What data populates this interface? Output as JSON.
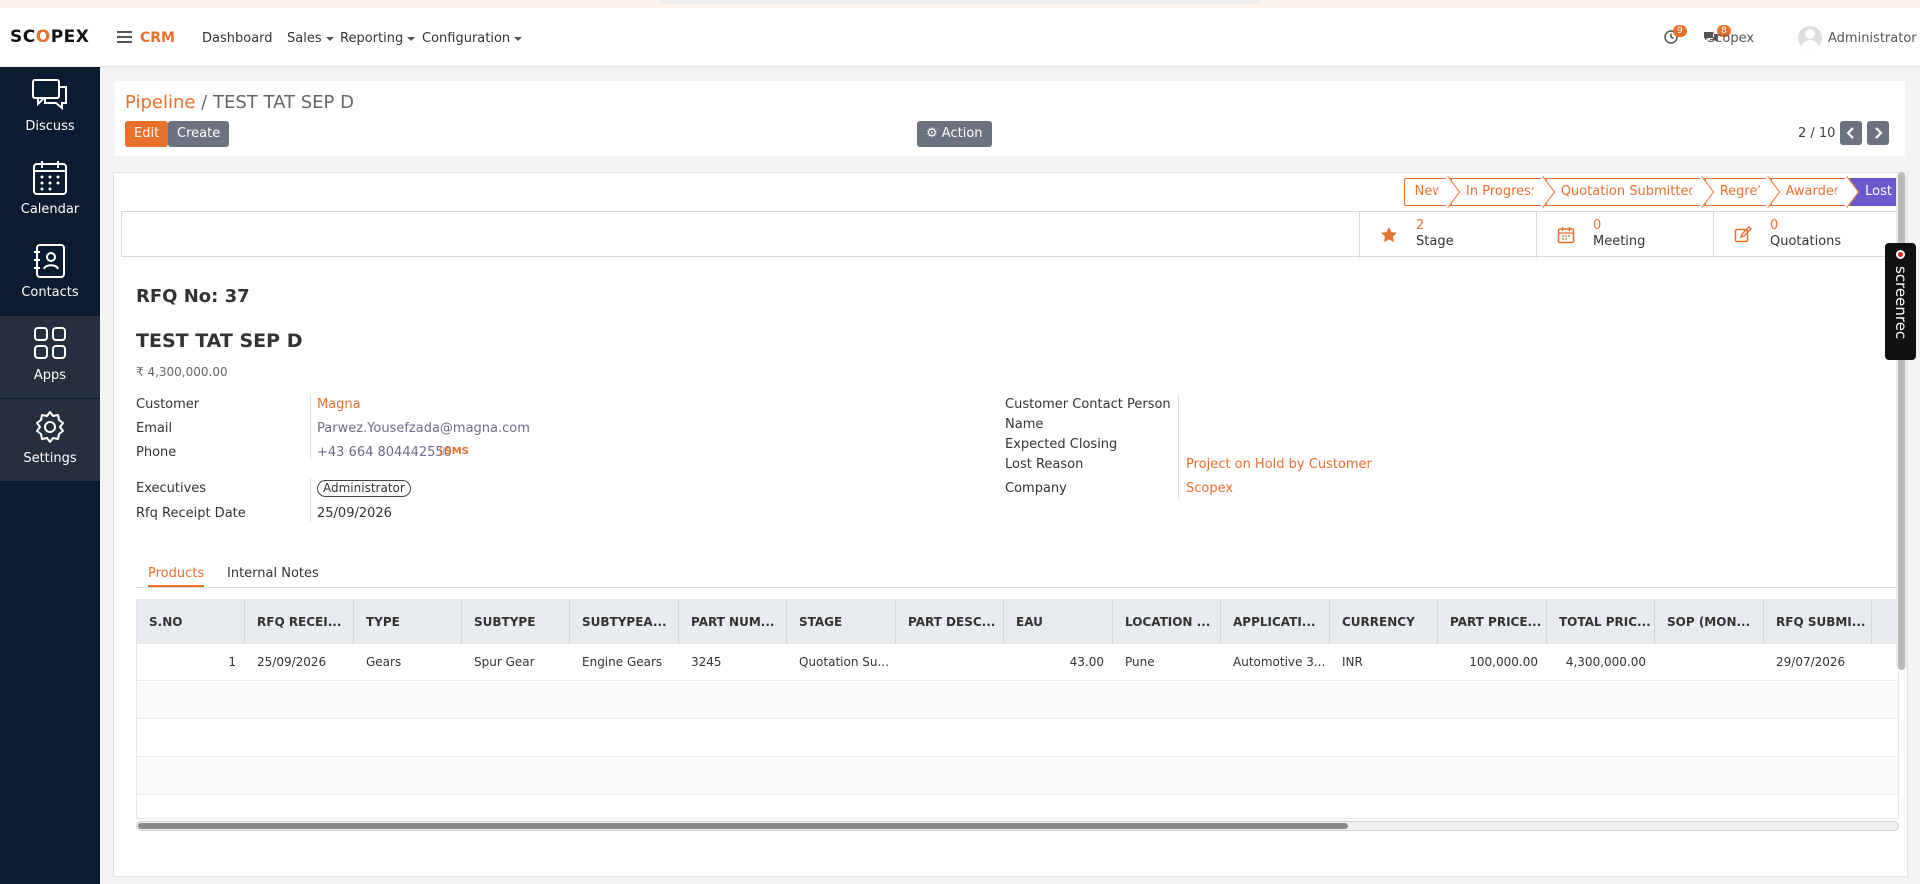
{
  "topbar": {
    "logo_left": "SC",
    "logo_o": "O",
    "logo_right": "PEX",
    "app_name": "CRM",
    "menu": [
      "Dashboard",
      "Sales",
      "Reporting",
      "Configuration"
    ],
    "activity_count": "9",
    "message_count": "8",
    "company": "Scopex",
    "user": "Administrator"
  },
  "sidebar": {
    "items": [
      {
        "label": "Discuss",
        "icon": "discuss-icon"
      },
      {
        "label": "Calendar",
        "icon": "calendar-icon"
      },
      {
        "label": "Contacts",
        "icon": "contacts-icon"
      },
      {
        "label": "Apps",
        "icon": "apps-icon"
      },
      {
        "label": "Settings",
        "icon": "settings-icon"
      }
    ]
  },
  "control": {
    "breadcrumb_link": "Pipeline",
    "breadcrumb_sep": " / ",
    "breadcrumb_current": "TEST TAT SEP D",
    "edit_label": "Edit",
    "create_label": "Create",
    "action_label": "Action",
    "pager": "2 / 10"
  },
  "stages": [
    "New",
    "In Progress",
    "Quotation Submitted",
    "Regret",
    "Awarded",
    "Lost"
  ],
  "stage_active": "Lost",
  "stats": {
    "stage_value": "2",
    "stage_label": "Stage",
    "meeting_value": "0",
    "meeting_label": "Meeting",
    "quotations_value": "0",
    "quotations_label": "Quotations"
  },
  "record": {
    "rfq_no": "RFQ No: 37",
    "title": "TEST TAT SEP D",
    "amount": "₹ 4,300,000.00"
  },
  "fields": {
    "customer_label": "Customer",
    "customer": "Magna",
    "email_label": "Email",
    "email": "Parwez.Yousefzada@magna.com",
    "phone_label": "Phone",
    "phone": "+43 664 804442550",
    "sms": "SMS",
    "executives_label": "Executives",
    "executive": "Administrator",
    "rfq_date_label": "Rfq Receipt Date",
    "rfq_date": "25/09/2026",
    "contact_label": "Customer Contact Person",
    "name_label": "Name",
    "closing_label": "Expected Closing",
    "lost_reason_label": "Lost Reason",
    "lost_reason": "Project on Hold by Customer",
    "company_label": "Company",
    "company": "Scopex"
  },
  "tabs": [
    "Products",
    "Internal Notes"
  ],
  "grid": {
    "headers": [
      "S.NO",
      "RFQ RECEI...",
      "TYPE",
      "SUBTYPE",
      "SUBTYPEA...",
      "PART NUM...",
      "STAGE",
      "PART DESC...",
      "EAU",
      "LOCATION ...",
      "APPLICATI...",
      "CURRENCY",
      "PART PRICE...",
      "TOTAL PRIC...",
      "SOP (MON...",
      "RFQ SUBMI..."
    ],
    "rows": [
      [
        "1",
        "25/09/2026",
        "Gears",
        "Spur Gear",
        "Engine Gears",
        "3245",
        "Quotation Su...",
        "",
        "43.00",
        "Pune",
        "Automotive 3...",
        "INR",
        "100,000.00",
        "4,300,000.00",
        "",
        "29/07/2026"
      ]
    ]
  },
  "overlay": {
    "screenrec": "screenrec"
  },
  "colors": {
    "accent": "#e8702a",
    "sidebar": "#0b1b30",
    "active_stage": "#6a5acd"
  }
}
